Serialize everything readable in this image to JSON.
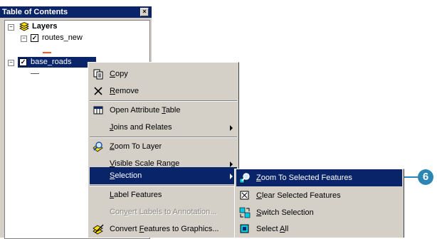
{
  "toc": {
    "title": "Table of Contents",
    "close_glyph": "×",
    "layers_label": "Layers",
    "layers": [
      {
        "name": "routes_new",
        "checked": true,
        "symbol_color": "#ff5a1e"
      },
      {
        "name": "base_roads",
        "checked": true,
        "selected": true,
        "symbol_color": "#555555"
      }
    ]
  },
  "context_menu": {
    "items": [
      {
        "pre": "",
        "acc": "C",
        "post": "opy",
        "icon": "copy-icon"
      },
      {
        "pre": "",
        "acc": "R",
        "post": "emove",
        "icon": "remove-icon"
      },
      {
        "pre": "Open Attribute ",
        "acc": "T",
        "post": "able",
        "icon": "table-icon"
      },
      {
        "pre": "",
        "acc": "J",
        "post": "oins and Relates",
        "icon": "",
        "submenu": true
      },
      {
        "pre": "",
        "acc": "Z",
        "post": "oom To Layer",
        "icon": "zoom-to-layer-icon"
      },
      {
        "pre": "",
        "acc": "V",
        "post": "isible Scale Range",
        "icon": "",
        "submenu": true
      },
      {
        "pre": "",
        "acc": "S",
        "post": "election",
        "icon": "",
        "submenu": true,
        "highlighted": true
      },
      {
        "pre": "",
        "acc": "L",
        "post": "abel Features",
        "icon": ""
      },
      {
        "pre": "Con",
        "acc": "v",
        "post": "ert Labels to Annotation...",
        "icon": "",
        "disabled": true
      },
      {
        "pre": "Convert ",
        "acc": "F",
        "post": "eatures to Graphics...",
        "icon": "convert-graphics-icon"
      }
    ]
  },
  "selection_submenu": {
    "items": [
      {
        "pre": "",
        "acc": "Z",
        "post": "oom To Selected Features",
        "icon": "zoom-to-selected-icon",
        "highlighted": true
      },
      {
        "pre": "",
        "acc": "C",
        "post": "lear Selected Features",
        "icon": "clear-selection-icon"
      },
      {
        "pre": "",
        "acc": "S",
        "post": "witch Selection",
        "icon": "switch-selection-icon"
      },
      {
        "pre": "Select ",
        "acc": "A",
        "post": "ll",
        "icon": "select-all-icon"
      }
    ]
  },
  "callout": {
    "number": "6"
  },
  "colors": {
    "highlight": "#0a246a",
    "callout": "#2b86b4",
    "menu_bg": "#d4d0c8"
  }
}
